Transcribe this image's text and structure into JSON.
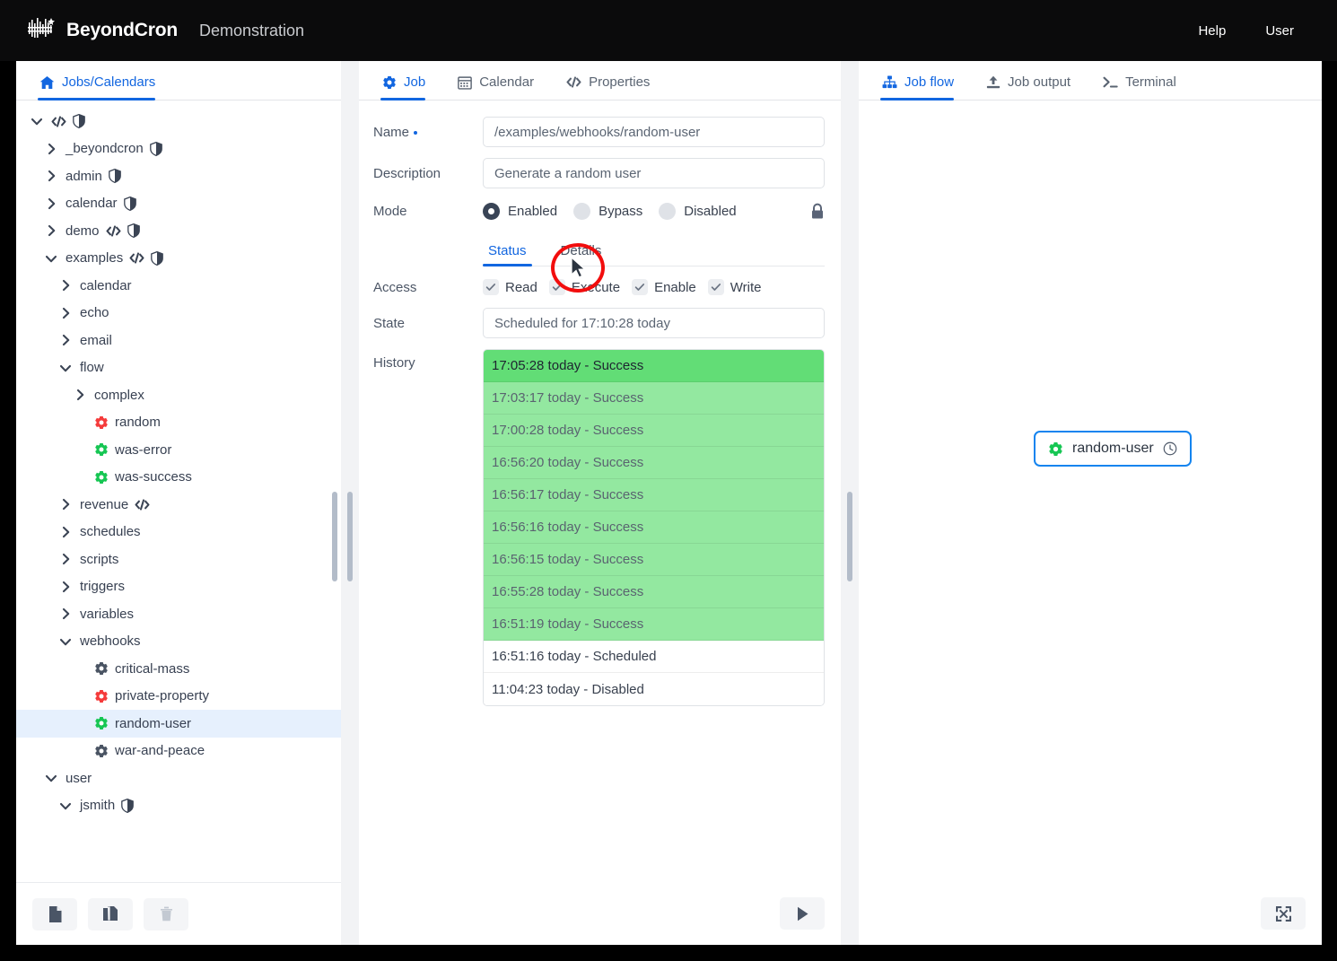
{
  "topbar": {
    "brand": "BeyondCron",
    "subtitle": "Demonstration",
    "logo_icon": "beyondcron-logo",
    "help_label": "Help",
    "user_label": "User"
  },
  "sidebar": {
    "tab_label": "Jobs/Calendars",
    "tab_icon": "home-icon",
    "tree": [
      {
        "label": "",
        "depth": 0,
        "chevron": "down",
        "icons": [
          "code-icon",
          "shield-icon"
        ],
        "selected": false
      },
      {
        "label": "_beyondcron",
        "depth": 1,
        "chevron": "right",
        "icons": [
          "shield-icon"
        ],
        "selected": false
      },
      {
        "label": "admin",
        "depth": 1,
        "chevron": "right",
        "icons": [
          "shield-icon"
        ],
        "selected": false
      },
      {
        "label": "calendar",
        "depth": 1,
        "chevron": "right",
        "icons": [
          "shield-icon"
        ],
        "selected": false
      },
      {
        "label": "demo",
        "depth": 1,
        "chevron": "right",
        "icons": [
          "code-icon",
          "shield-icon"
        ],
        "selected": false
      },
      {
        "label": "examples",
        "depth": 1,
        "chevron": "down",
        "icons": [
          "code-icon",
          "shield-icon"
        ],
        "selected": false
      },
      {
        "label": "calendar",
        "depth": 2,
        "chevron": "right",
        "icons": [],
        "selected": false
      },
      {
        "label": "echo",
        "depth": 2,
        "chevron": "right",
        "icons": [],
        "selected": false
      },
      {
        "label": "email",
        "depth": 2,
        "chevron": "right",
        "icons": [],
        "selected": false
      },
      {
        "label": "flow",
        "depth": 2,
        "chevron": "down",
        "icons": [],
        "selected": false
      },
      {
        "label": "complex",
        "depth": 3,
        "chevron": "right",
        "icons": [],
        "selected": false
      },
      {
        "label": "random",
        "depth": 3,
        "chevron": "none",
        "icons": [
          "gear-icon-red"
        ],
        "selected": false
      },
      {
        "label": "was-error",
        "depth": 3,
        "chevron": "none",
        "icons": [
          "gear-icon-green"
        ],
        "selected": false
      },
      {
        "label": "was-success",
        "depth": 3,
        "chevron": "none",
        "icons": [
          "gear-icon-green"
        ],
        "selected": false
      },
      {
        "label": "revenue",
        "depth": 2,
        "chevron": "right",
        "icons": [
          "code-icon"
        ],
        "selected": false
      },
      {
        "label": "schedules",
        "depth": 2,
        "chevron": "right",
        "icons": [],
        "selected": false
      },
      {
        "label": "scripts",
        "depth": 2,
        "chevron": "right",
        "icons": [],
        "selected": false
      },
      {
        "label": "triggers",
        "depth": 2,
        "chevron": "right",
        "icons": [],
        "selected": false
      },
      {
        "label": "variables",
        "depth": 2,
        "chevron": "right",
        "icons": [],
        "selected": false
      },
      {
        "label": "webhooks",
        "depth": 2,
        "chevron": "down",
        "icons": [],
        "selected": false
      },
      {
        "label": "critical-mass",
        "depth": 3,
        "chevron": "none",
        "icons": [
          "gear-icon-grey"
        ],
        "selected": false
      },
      {
        "label": "private-property",
        "depth": 3,
        "chevron": "none",
        "icons": [
          "gear-icon-red"
        ],
        "selected": false
      },
      {
        "label": "random-user",
        "depth": 3,
        "chevron": "none",
        "icons": [
          "gear-icon-green"
        ],
        "selected": true
      },
      {
        "label": "war-and-peace",
        "depth": 3,
        "chevron": "none",
        "icons": [
          "gear-icon-grey"
        ],
        "selected": false
      },
      {
        "label": "user",
        "depth": 1,
        "chevron": "down",
        "icons": [],
        "selected": false
      },
      {
        "label": "jsmith",
        "depth": 2,
        "chevron": "down",
        "icons": [
          "shield-icon"
        ],
        "selected": false
      }
    ],
    "toolbar": [
      {
        "name": "new-file-button",
        "icon": "file-icon",
        "enabled": true
      },
      {
        "name": "copy-button",
        "icon": "copy-icon",
        "enabled": true
      },
      {
        "name": "delete-button",
        "icon": "trash-icon",
        "enabled": false
      }
    ]
  },
  "center": {
    "tabs": [
      {
        "label": "Job",
        "icon": "gear-icon",
        "active": true
      },
      {
        "label": "Calendar",
        "icon": "calendar-icon",
        "active": false
      },
      {
        "label": "Properties",
        "icon": "code-icon",
        "active": false
      }
    ],
    "name_label": "Name",
    "name_value": "/examples/webhooks/random-user",
    "description_label": "Description",
    "description_value": "Generate a random user",
    "mode_label": "Mode",
    "mode_options": [
      {
        "label": "Enabled",
        "selected": true
      },
      {
        "label": "Bypass",
        "selected": false
      },
      {
        "label": "Disabled",
        "selected": false
      }
    ],
    "lock_icon": "lock-icon",
    "subtabs": [
      {
        "label": "Status",
        "active": true
      },
      {
        "label": "Details",
        "active": false
      }
    ],
    "access_label": "Access",
    "access_options": [
      {
        "label": "Read",
        "checked": true
      },
      {
        "label": "Execute",
        "checked": true
      },
      {
        "label": "Enable",
        "checked": true
      },
      {
        "label": "Write",
        "checked": true
      }
    ],
    "state_label": "State",
    "state_value": "Scheduled for 17:10:28 today",
    "history_label": "History",
    "history": [
      {
        "text": "17:05:28 today - Success",
        "style": "top"
      },
      {
        "text": "17:03:17 today - Success",
        "style": "success"
      },
      {
        "text": "17:00:28 today - Success",
        "style": "success"
      },
      {
        "text": "16:56:20 today - Success",
        "style": "success"
      },
      {
        "text": "16:56:17 today - Success",
        "style": "success"
      },
      {
        "text": "16:56:16 today - Success",
        "style": "success"
      },
      {
        "text": "16:56:15 today - Success",
        "style": "success"
      },
      {
        "text": "16:55:28 today - Success",
        "style": "success"
      },
      {
        "text": "16:51:19 today - Success",
        "style": "success"
      },
      {
        "text": "16:51:16 today - Scheduled",
        "style": "plain"
      },
      {
        "text": "11:04:23 today - Disabled",
        "style": "plain"
      }
    ],
    "run_button_icon": "play-icon"
  },
  "right": {
    "tabs": [
      {
        "label": "Job flow",
        "icon": "sitemap-icon",
        "active": true
      },
      {
        "label": "Job output",
        "icon": "upload-icon",
        "active": false
      },
      {
        "label": "Terminal",
        "icon": "terminal-icon",
        "active": false
      }
    ],
    "node": {
      "label": "random-user",
      "gear_icon": "gear-icon-green",
      "clock_icon": "clock-icon"
    },
    "fullscreen_icon": "expand-icon"
  },
  "colors": {
    "accent": "#1266e0",
    "success_top": "#62dd76",
    "success": "#93e8a0",
    "gear_green": "#16c653",
    "gear_red": "#f53b3b",
    "gear_grey": "#4a5463",
    "annotation": "#f20d0d"
  }
}
